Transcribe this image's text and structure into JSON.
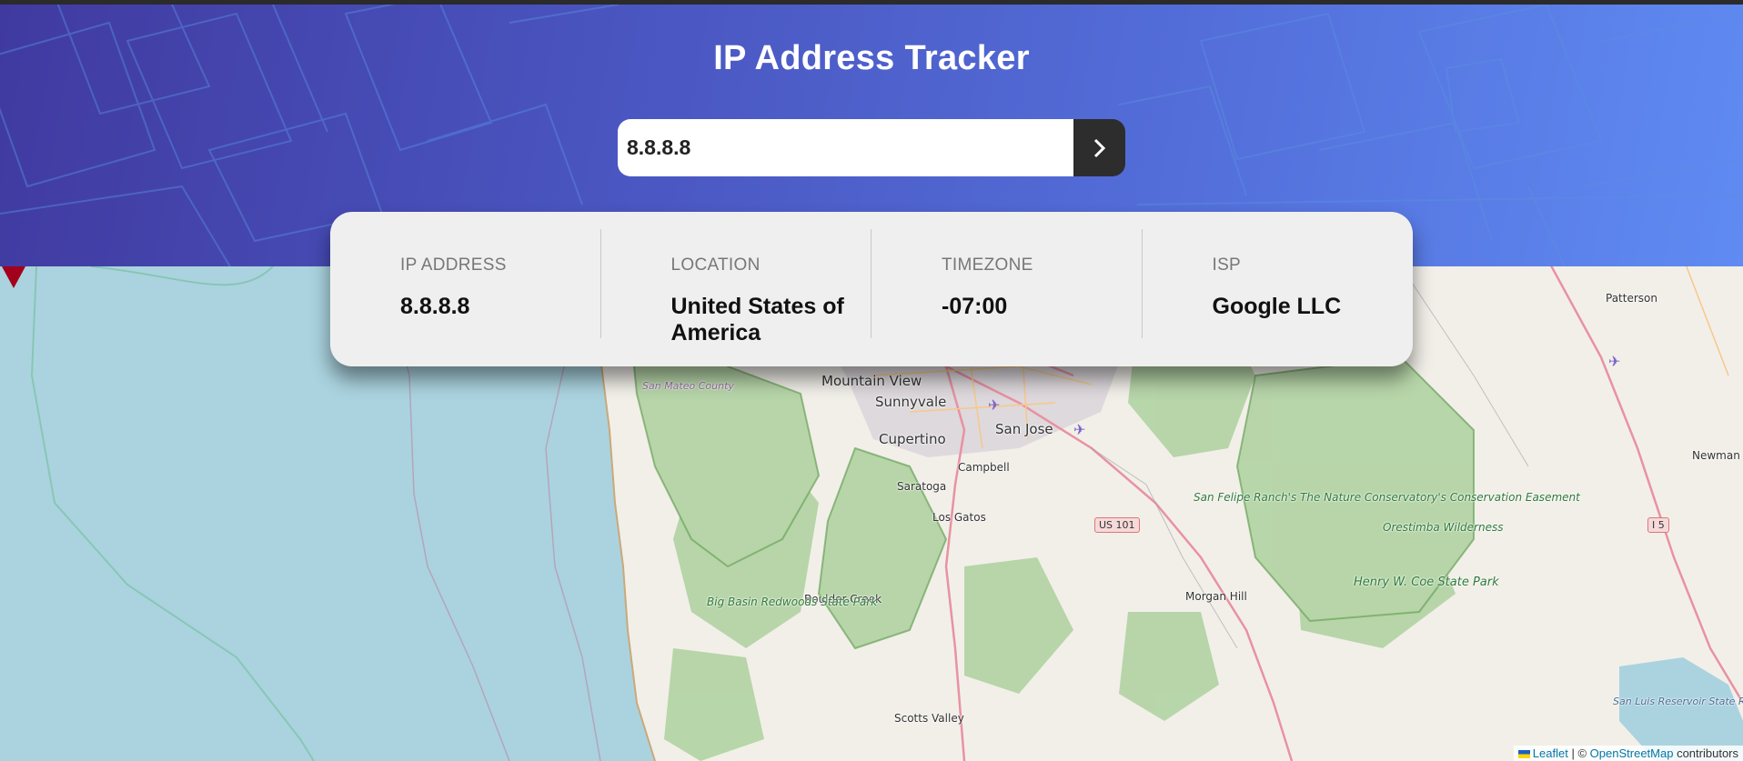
{
  "app": {
    "title": "IP Address Tracker"
  },
  "search": {
    "value": "8.8.8.8",
    "submit_icon": "chevron-right-icon"
  },
  "info": [
    {
      "label": "IP ADDRESS",
      "value": "8.8.8.8"
    },
    {
      "label": "LOCATION",
      "value": "United States of America"
    },
    {
      "label": "TIMEZONE",
      "value": "-07:00"
    },
    {
      "label": "ISP",
      "value": "Google LLC"
    }
  ],
  "map": {
    "marker_icon": "location-marker-icon",
    "labels": {
      "mountain_view": "Mountain View",
      "sunnyvale": "Sunnyvale",
      "san_jose": "San Jose",
      "cupertino": "Cupertino",
      "campbell": "Campbell",
      "saratoga": "Saratoga",
      "los_gatos": "Los Gatos",
      "boulder_creek": "Boulder Creek",
      "morgan_hill": "Morgan Hill",
      "scotts_valley": "Scotts Valley",
      "patterson": "Patterson",
      "newman": "Newman",
      "san_mateo_county": "San Mateo County",
      "san_felipe": "San Felipe Ranch's The Nature Conservatory's Conservation Easement",
      "orestimba": "Orestimba Wilderness",
      "henry_coe": "Henry W. Coe State Park",
      "big_basin": "Big Basin Redwoods State Park",
      "san_luis": "San Luis Reservoir State Recreation Area",
      "us101": "US 101",
      "i5": "I 5"
    }
  },
  "attribution": {
    "leaflet": "Leaflet",
    "separator": "| ©",
    "osm": "OpenStreetMap",
    "contributors": "contributors"
  },
  "colors": {
    "header_gradient_start": "#403aa0",
    "header_gradient_end": "#5f8bf2",
    "card_bg": "#efefef",
    "button_bg": "#2d2d2d",
    "ocean": "#aad3df",
    "land": "#f2efe9",
    "forest": "#add19e",
    "marker": "#a3001c"
  }
}
